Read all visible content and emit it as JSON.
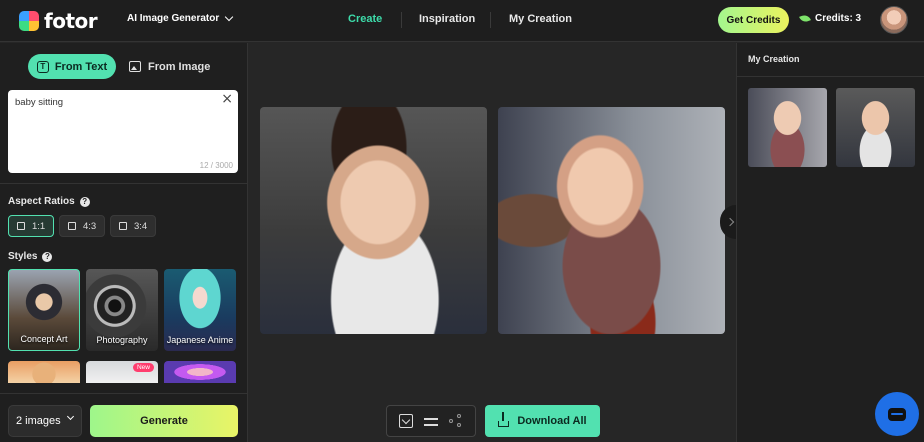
{
  "header": {
    "logo_text": "fotor",
    "generator_menu": "AI Image Generator",
    "nav": [
      "Create",
      "Inspiration",
      "My Creation"
    ],
    "get_credits": "Get Credits",
    "credits": "Credits: 3"
  },
  "left": {
    "tabs": {
      "from_text": "From Text",
      "from_image": "From Image"
    },
    "prompt": {
      "value": "baby sitting",
      "count": "12 / 3000"
    },
    "aspect_label": "Aspect Ratios",
    "ratios": [
      "1:1",
      "4:3",
      "3:4"
    ],
    "styles_label": "Styles",
    "styles": [
      "Concept Art",
      "Photography",
      "Japanese Anime"
    ],
    "new_badge": "New",
    "count_select": "2 images",
    "generate": "Generate"
  },
  "canvas": {
    "download_all": "Download All"
  },
  "right": {
    "title": "My Creation"
  },
  "colors": {
    "accent": "#52e1b0",
    "nav_active": "#3ddcaa",
    "credits_gradient": [
      "#a3f78e",
      "#ecf25e"
    ],
    "chat": "#1f6fe6"
  }
}
